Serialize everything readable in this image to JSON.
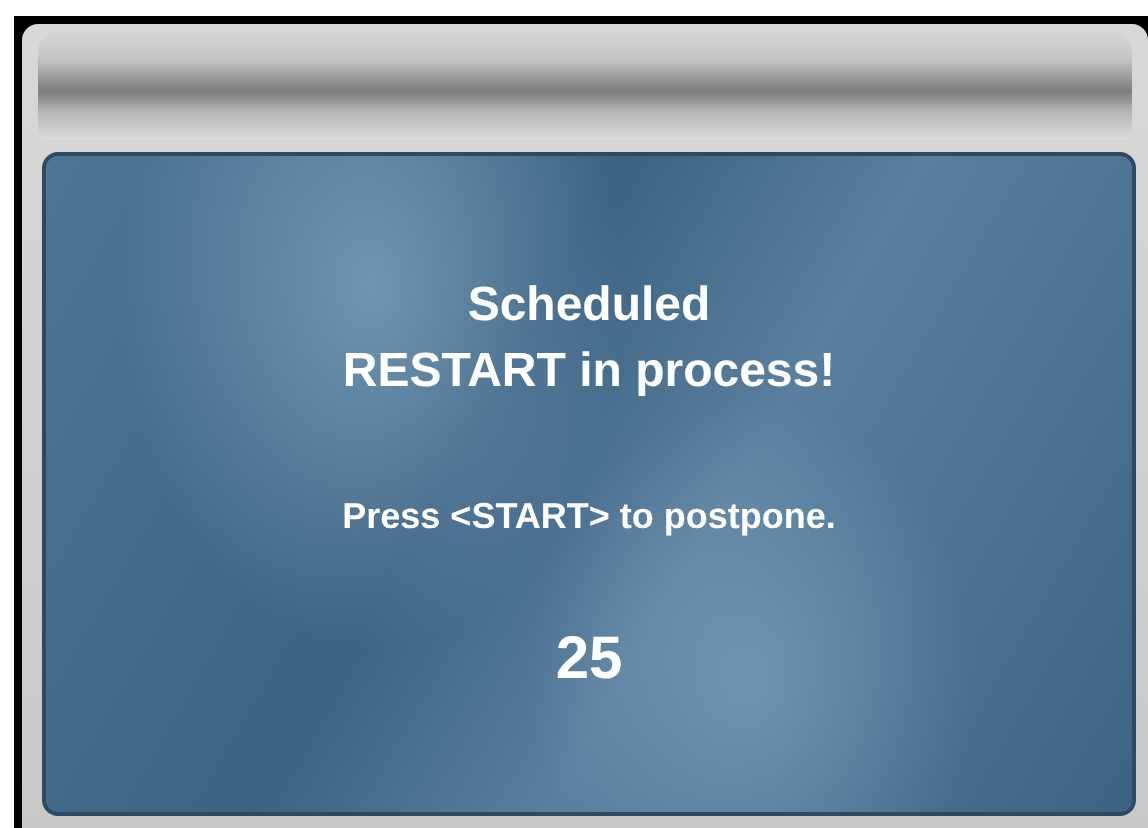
{
  "dialog": {
    "title_lines": [
      "Scheduled",
      "RESTART in process!"
    ],
    "message": "Press <START> to postpone.",
    "countdown": "25"
  }
}
